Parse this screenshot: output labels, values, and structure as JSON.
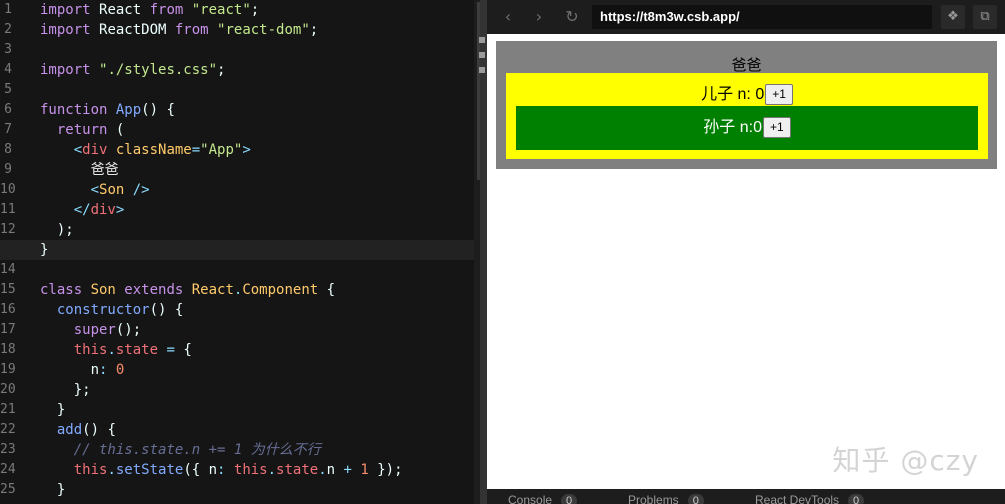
{
  "editor": {
    "line_numbers": [
      "1",
      "2",
      "3",
      "4",
      "5",
      "6",
      "7",
      "8",
      "9",
      "10",
      "11",
      "12",
      "13",
      "14",
      "15",
      "16",
      "17",
      "18",
      "19",
      "20",
      "21",
      "22",
      "23",
      "24",
      "25"
    ],
    "active_line": "13",
    "lines": [
      [
        {
          "t": "import ",
          "c": "kw"
        },
        {
          "t": "React ",
          "c": "plain"
        },
        {
          "t": "from ",
          "c": "kw"
        },
        {
          "t": "\"react\"",
          "c": "str"
        },
        {
          "t": ";",
          "c": "plain"
        }
      ],
      [
        {
          "t": "import ",
          "c": "kw"
        },
        {
          "t": "ReactDOM ",
          "c": "plain"
        },
        {
          "t": "from ",
          "c": "kw"
        },
        {
          "t": "\"react-dom\"",
          "c": "str"
        },
        {
          "t": ";",
          "c": "plain"
        }
      ],
      [],
      [
        {
          "t": "import ",
          "c": "kw"
        },
        {
          "t": "\"./styles.css\"",
          "c": "str"
        },
        {
          "t": ";",
          "c": "plain"
        }
      ],
      [],
      [
        {
          "t": "function ",
          "c": "kw"
        },
        {
          "t": "App",
          "c": "fn"
        },
        {
          "t": "() {",
          "c": "plain"
        }
      ],
      [
        {
          "t": "  return ",
          "c": "kw"
        },
        {
          "t": "(",
          "c": "plain"
        }
      ],
      [
        {
          "t": "    <",
          "c": "punc"
        },
        {
          "t": "div ",
          "c": "tag"
        },
        {
          "t": "className",
          "c": "attr"
        },
        {
          "t": "=",
          "c": "punc"
        },
        {
          "t": "\"App\"",
          "c": "str"
        },
        {
          "t": ">",
          "c": "punc"
        }
      ],
      [
        {
          "t": "      爸爸",
          "c": "txt"
        }
      ],
      [
        {
          "t": "      <",
          "c": "punc"
        },
        {
          "t": "Son ",
          "c": "cls"
        },
        {
          "t": "/>",
          "c": "punc"
        }
      ],
      [
        {
          "t": "    </",
          "c": "punc"
        },
        {
          "t": "div",
          "c": "tag"
        },
        {
          "t": ">",
          "c": "punc"
        }
      ],
      [
        {
          "t": "  );",
          "c": "plain"
        }
      ],
      [
        {
          "t": "}",
          "c": "plain"
        }
      ],
      [],
      [
        {
          "t": "class ",
          "c": "kw"
        },
        {
          "t": "Son ",
          "c": "cls"
        },
        {
          "t": "extends ",
          "c": "kw"
        },
        {
          "t": "React",
          "c": "cls"
        },
        {
          "t": ".",
          "c": "punc"
        },
        {
          "t": "Component ",
          "c": "cls"
        },
        {
          "t": "{",
          "c": "plain"
        }
      ],
      [
        {
          "t": "  constructor",
          "c": "fn"
        },
        {
          "t": "() {",
          "c": "plain"
        }
      ],
      [
        {
          "t": "    super",
          "c": "kw"
        },
        {
          "t": "();",
          "c": "plain"
        }
      ],
      [
        {
          "t": "    this",
          "c": "tag"
        },
        {
          "t": ".",
          "c": "punc"
        },
        {
          "t": "state ",
          "c": "tag"
        },
        {
          "t": "= ",
          "c": "punc"
        },
        {
          "t": "{",
          "c": "plain"
        }
      ],
      [
        {
          "t": "      n",
          "c": "plain"
        },
        {
          "t": ": ",
          "c": "punc"
        },
        {
          "t": "0",
          "c": "num"
        }
      ],
      [
        {
          "t": "    };",
          "c": "plain"
        }
      ],
      [
        {
          "t": "  }",
          "c": "plain"
        }
      ],
      [
        {
          "t": "  add",
          "c": "fn"
        },
        {
          "t": "() {",
          "c": "plain"
        }
      ],
      [
        {
          "t": "    // this.state.n += 1 为什么不行",
          "c": "cmt"
        }
      ],
      [
        {
          "t": "    this",
          "c": "tag"
        },
        {
          "t": ".",
          "c": "punc"
        },
        {
          "t": "setState",
          "c": "fn"
        },
        {
          "t": "({ n",
          "c": "plain"
        },
        {
          "t": ": ",
          "c": "punc"
        },
        {
          "t": "this",
          "c": "tag"
        },
        {
          "t": ".",
          "c": "punc"
        },
        {
          "t": "state",
          "c": "tag"
        },
        {
          "t": ".",
          "c": "punc"
        },
        {
          "t": "n ",
          "c": "plain"
        },
        {
          "t": "+ ",
          "c": "punc"
        },
        {
          "t": "1 ",
          "c": "num"
        },
        {
          "t": "});",
          "c": "plain"
        }
      ],
      [
        {
          "t": "  }",
          "c": "plain"
        }
      ]
    ]
  },
  "browser": {
    "back_icon": "‹",
    "forward_icon": "›",
    "reload_icon": "↻",
    "url": "https://t8m3w.csb.app/",
    "action_icon_1": "❖",
    "action_icon_2": "⧉",
    "page": {
      "dad_label": "爸爸",
      "son_text": "儿子 n: 0",
      "son_button": "+1",
      "grandson_text": "孙子 n:0",
      "grandson_button": "+1",
      "colors": {
        "dad": "#808080",
        "son": "#ffff00",
        "grandson": "#008000"
      }
    },
    "watermark": "知乎 @czy",
    "bottom_tabs": [
      {
        "label": "Console",
        "count": "0"
      },
      {
        "label": "Problems",
        "count": "0"
      },
      {
        "label": "React DevTools",
        "count": "0"
      }
    ]
  }
}
